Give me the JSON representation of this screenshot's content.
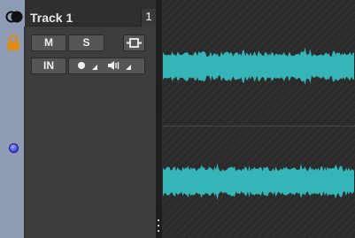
{
  "track": {
    "name": "Track 1",
    "number": "1",
    "color": "#8f9cb5",
    "icons": {
      "visibility": "visibility-toggle-icon",
      "lock": "lock-icon",
      "input_marker": "blue-dot-indicator"
    }
  },
  "buttons": {
    "mute": "M",
    "solo": "S",
    "input": "IN",
    "trim_icon": "trim-insert-icon",
    "record_icon": "record-icon",
    "record_mode_icon": "dropdown-triangle-icon",
    "monitor_icon": "monitor-speaker-icon",
    "monitor_mode_icon": "dropdown-triangle-icon"
  },
  "colors": {
    "waveform": "#35b5b8",
    "accent_orange": "#e08a10",
    "indicator_blue": "#4a55f0"
  }
}
